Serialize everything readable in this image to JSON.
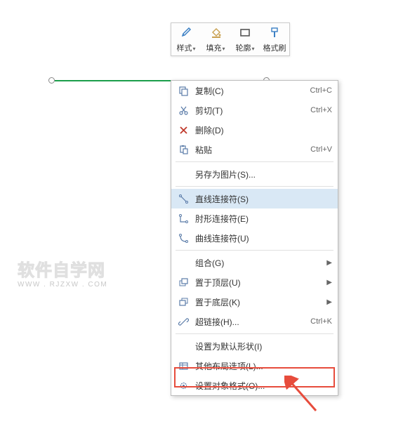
{
  "toolbar": {
    "style": "样式",
    "fill": "填充",
    "outline": "轮廓",
    "formatPainter": "格式刷"
  },
  "watermark": {
    "main": "软件自学网",
    "sub": "WWW . RJZXW . COM"
  },
  "menu": {
    "copy": {
      "label": "复制(C)",
      "shortcut": "Ctrl+C"
    },
    "cut": {
      "label": "剪切(T)",
      "shortcut": "Ctrl+X"
    },
    "delete": {
      "label": "删除(D)"
    },
    "paste": {
      "label": "粘贴",
      "shortcut": "Ctrl+V"
    },
    "saveAsImage": {
      "label": "另存为图片(S)..."
    },
    "straightConnector": {
      "label": "直线连接符(S)"
    },
    "elbowConnector": {
      "label": "肘形连接符(E)"
    },
    "curvedConnector": {
      "label": "曲线连接符(U)"
    },
    "group": {
      "label": "组合(G)"
    },
    "bringToFront": {
      "label": "置于顶层(U)"
    },
    "sendToBack": {
      "label": "置于底层(K)"
    },
    "hyperlink": {
      "label": "超链接(H)...",
      "shortcut": "Ctrl+K"
    },
    "setAsDefault": {
      "label": "设置为默认形状(I)"
    },
    "moreLayout": {
      "label": "其他布局选项(L)..."
    },
    "formatObject": {
      "label": "设置对象格式(O)..."
    }
  }
}
